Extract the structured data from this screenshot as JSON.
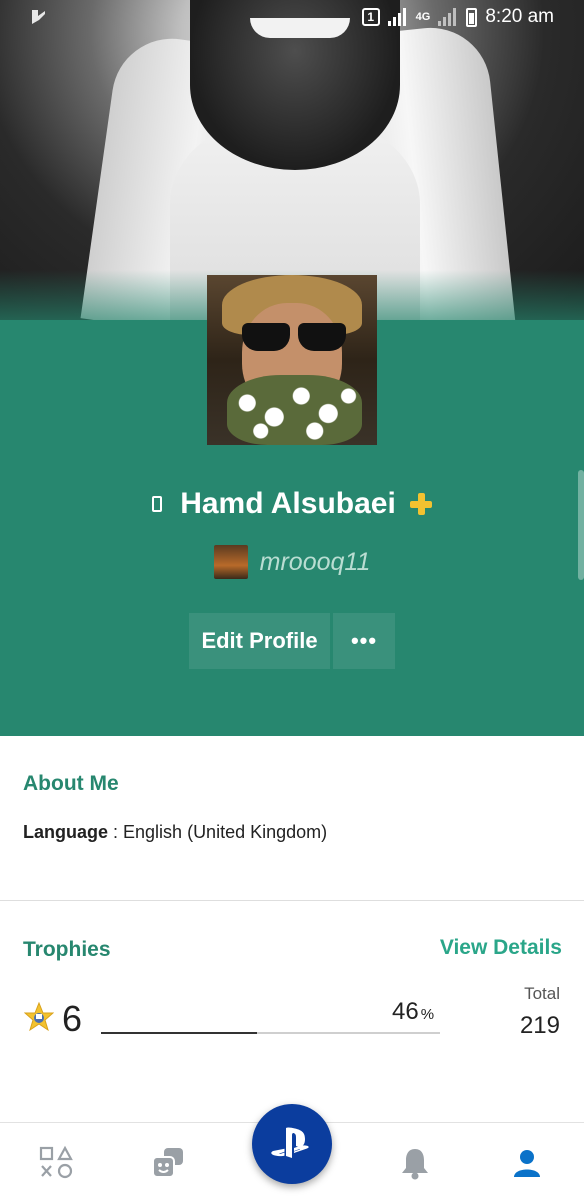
{
  "status_bar": {
    "sim_slot": "1",
    "network": "4G",
    "time": "8:20 am"
  },
  "profile": {
    "name": "Hamd Alsubaei",
    "psn_id": "mroooq11",
    "edit_profile_label": "Edit Profile",
    "more_label": "•••",
    "colors": {
      "header_green": "#27876f",
      "button_green": "#3a917c",
      "plus_gold": "#f2c230"
    }
  },
  "about": {
    "title": "About Me",
    "language_label": "Language",
    "language_separator": " : ",
    "language_value": "English (United Kingdom)"
  },
  "trophies": {
    "title": "Trophies",
    "view_details_label": "View Details",
    "level": "6",
    "progress_percent": "46",
    "percent_sign": "%",
    "progress_fraction": 0.46,
    "total_label": "Total",
    "total_value": "219"
  },
  "bottom_nav": {
    "items": [
      "games-icon",
      "friends-icon",
      "playstation-home-icon",
      "notifications-icon",
      "profile-icon"
    ],
    "active": "profile-icon",
    "colors": {
      "inactive": "#9aa0a6",
      "active": "#0a72c9",
      "fab": "#0b3d9e"
    }
  }
}
